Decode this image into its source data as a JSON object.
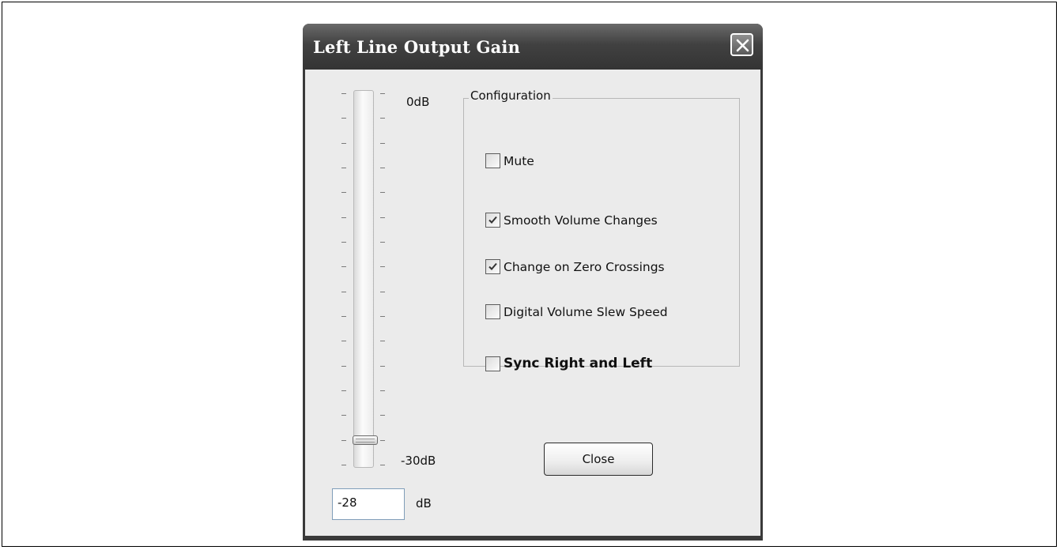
{
  "window": {
    "title": "Left Line Output Gain"
  },
  "slider": {
    "max_label": "0dB",
    "min_label": "-30dB",
    "min": -30,
    "max": 0,
    "value": -28
  },
  "value_field": {
    "value": "-28",
    "unit": "dB"
  },
  "configuration": {
    "legend": "Configuration",
    "options": [
      {
        "label": "Mute",
        "checked": false
      },
      {
        "label": "Smooth Volume Changes",
        "checked": true
      },
      {
        "label": "Change on Zero Crossings",
        "checked": true
      },
      {
        "label": "Digital Volume Slew Speed",
        "checked": false
      },
      {
        "label": "Sync Right and Left",
        "checked": false
      }
    ]
  },
  "buttons": {
    "close_label": "Close"
  },
  "icons": {
    "close": "close-icon",
    "check": "checkmark-icon"
  }
}
